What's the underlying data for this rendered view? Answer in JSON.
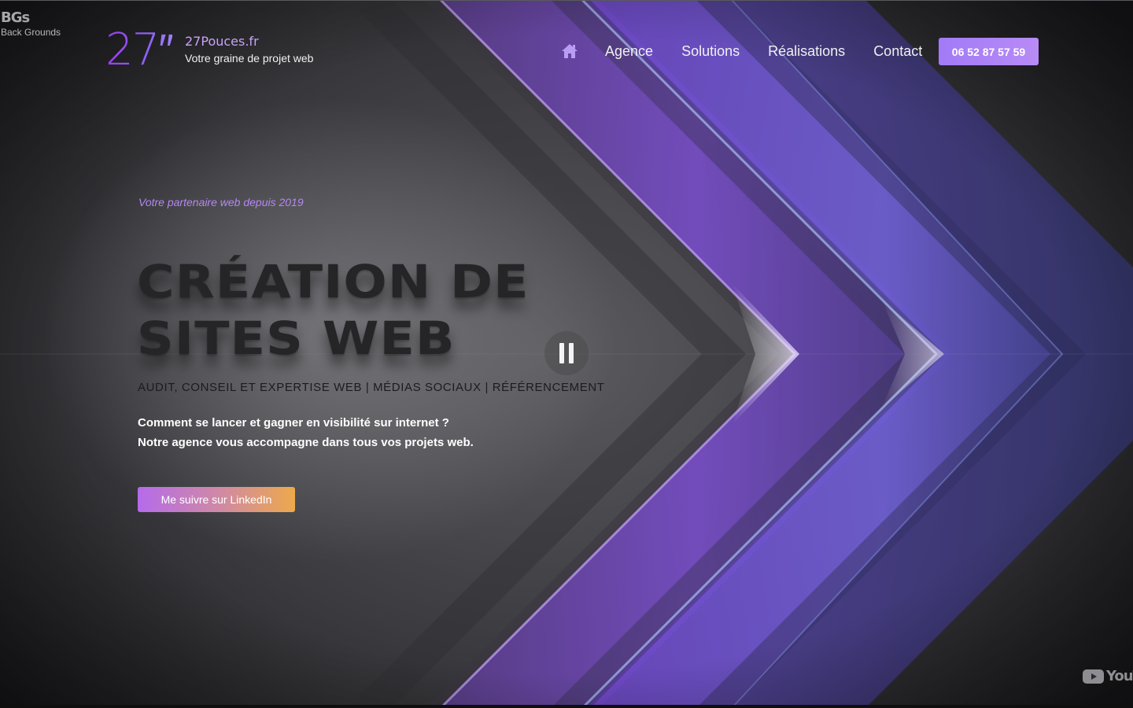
{
  "badge": {
    "title": "BGs",
    "subtitle": "Back Grounds"
  },
  "logo": {
    "mark": "27″",
    "domain": "27Pouces.fr",
    "tagline": "Votre graine de projet web"
  },
  "nav": {
    "home_icon": "home-icon",
    "items": [
      {
        "label": "Agence"
      },
      {
        "label": "Solutions"
      },
      {
        "label": "Réalisations"
      },
      {
        "label": "Contact"
      }
    ],
    "phone": "06 52 87 57 59"
  },
  "hero": {
    "kicker": "Votre partenaire web depuis 2019",
    "title_line1": "CRÉATION DE",
    "title_line2": "SITES WEB",
    "subtitle": "AUDIT, CONSEIL ET EXPERTISE WEB | MÉDIAS SOCIAUX | RÉFÉRENCEMENT",
    "desc_line1": "Comment se lancer et gagner en visibilité sur internet ?",
    "desc_line2": "Notre agence vous accompagne dans tous vos projets web.",
    "cta": "Me suivre sur LinkedIn"
  },
  "video": {
    "control_icon": "pause-icon",
    "brand": "YouTu"
  },
  "colors": {
    "accent": "#a27af7",
    "kicker": "#b687f2",
    "cta_start": "#b56bea",
    "cta_end": "#eda94b",
    "chevron": "#7a4fd6"
  }
}
